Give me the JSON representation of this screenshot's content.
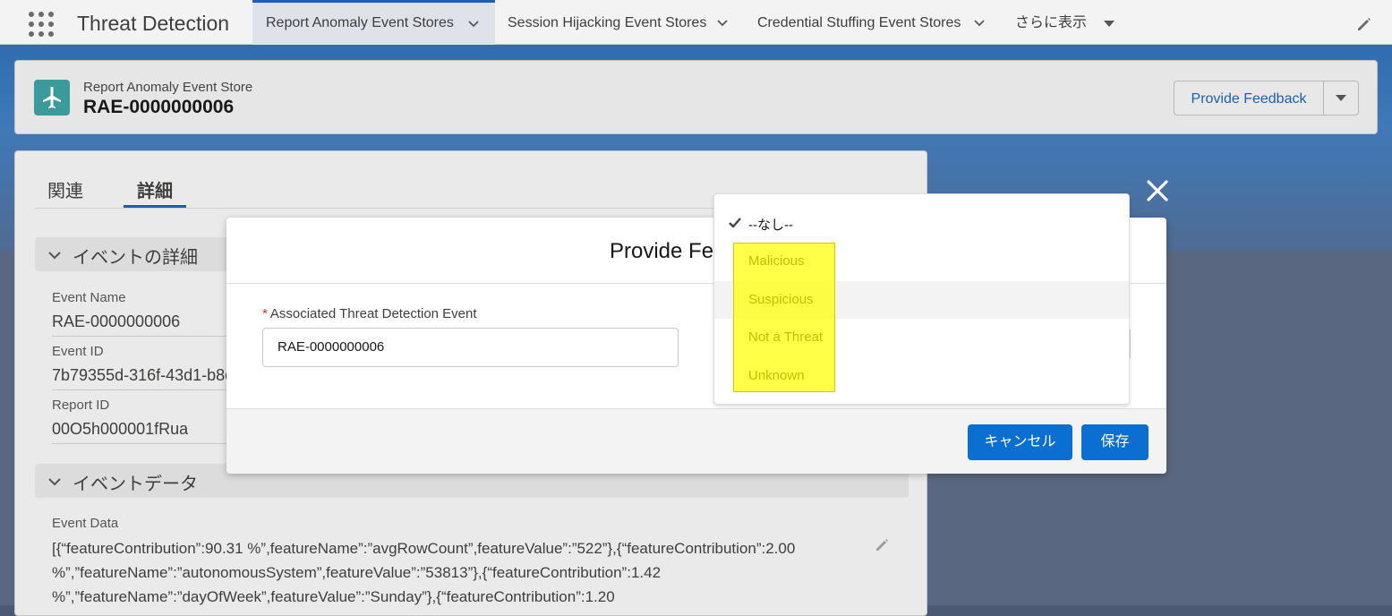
{
  "app": {
    "title": "Threat Detection"
  },
  "nav_tabs": [
    {
      "label": "Report Anomaly Event Stores",
      "active": true
    },
    {
      "label": "Session Hijacking Event Stores",
      "active": false
    },
    {
      "label": "Credential Stuffing Event Stores",
      "active": false
    },
    {
      "label": "さらに表示",
      "active": false
    }
  ],
  "record": {
    "type_label": "Report Anomaly Event Store",
    "name": "RAE-0000000006",
    "feedback_button": "Provide Feedback"
  },
  "detail": {
    "tabs": [
      "関連",
      "詳細"
    ],
    "section_event_details": "イベントの詳細",
    "fields": [
      {
        "label": "Event Name",
        "value": "RAE-0000000006"
      },
      {
        "label": "Event ID",
        "value": "7b79355d-316f-43d1-b8c"
      },
      {
        "label": "Report ID",
        "value": "00O5h000001fRua"
      }
    ],
    "section_event_data": "イベントデータ",
    "event_data_label": "Event Data",
    "event_data_lines": [
      "[{“featureContribution”:90.31 %”,featureName”:”avgRowCount”,featureValue”:”522”},{“featureContribution”:2.00",
      "%”,”featureName”:”autonomousSystem”,featureValue”:”53813”},{“featureContribution”:1.42",
      "%”,”featureName”:”dayOfWeek”,featureValue”:”Sunday”},{“featureContribution”:1.20"
    ]
  },
  "modal": {
    "title": "Provide Fe",
    "field_label": "Associated Threat Detection Event",
    "field_value": "RAE-0000000006",
    "cancel_button": "キャンセル",
    "save_button": "保存"
  },
  "dropdown": {
    "options": [
      {
        "label": "--なし--",
        "selected": true
      },
      {
        "label": "Malicious",
        "selected": false
      },
      {
        "label": "Suspicious",
        "selected": false,
        "hovered": true
      },
      {
        "label": "Not a Threat",
        "selected": false
      },
      {
        "label": "Unknown",
        "selected": false
      }
    ]
  },
  "colors": {
    "brand_blue": "#0b6fd1",
    "record_icon": "#3b9a9c",
    "highlight": "#ffff00"
  }
}
